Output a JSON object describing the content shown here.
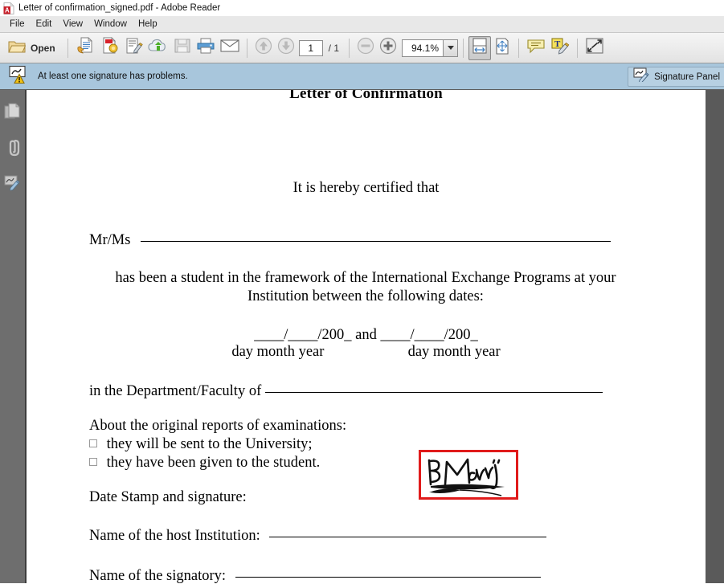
{
  "window": {
    "title": "Letter of confirmation_signed.pdf - Adobe Reader",
    "app_icon": "pdf-document-icon"
  },
  "menubar": {
    "items": [
      {
        "label": "File"
      },
      {
        "label": "Edit"
      },
      {
        "label": "View"
      },
      {
        "label": "Window"
      },
      {
        "label": "Help"
      }
    ]
  },
  "toolbar": {
    "open_label": "Open",
    "open_icon": "folder-open-icon",
    "buttons": [
      {
        "name": "create-pdf-icon",
        "label": "Create PDF"
      },
      {
        "name": "export-pdf-icon",
        "label": "Export PDF"
      },
      {
        "name": "edit-pdf-icon",
        "label": "Edit PDF"
      },
      {
        "name": "upload-cloud-icon",
        "label": "Send files"
      },
      {
        "name": "save-icon",
        "label": "Save",
        "disabled": true
      },
      {
        "name": "print-icon",
        "label": "Print"
      },
      {
        "name": "email-icon",
        "label": "Email"
      }
    ],
    "page_prev_icon": "arrow-up-icon",
    "page_next_icon": "arrow-down-icon",
    "page_number": "1",
    "page_total": "/ 1",
    "zoom_out_icon": "minus-circle-icon",
    "zoom_in_icon": "plus-circle-icon",
    "zoom_value": "94.1%",
    "right_buttons": [
      {
        "name": "fit-width-icon",
        "label": "Fit Width",
        "active": true
      },
      {
        "name": "fit-page-icon",
        "label": "Fit Page"
      },
      {
        "name": "comment-icon",
        "label": "Add Sticky Note"
      },
      {
        "name": "highlight-text-icon",
        "label": "Highlight Text"
      },
      {
        "name": "read-mode-icon",
        "label": "Read Mode"
      }
    ]
  },
  "notification": {
    "icon": "signature-warning-icon",
    "message": "At least one signature has problems.",
    "panel_button_label": "Signature Panel",
    "panel_button_icon": "signature-panel-icon"
  },
  "navpane": {
    "items": [
      {
        "name": "page-thumbnails-icon",
        "label": "Page Thumbnails"
      },
      {
        "name": "attachments-icon",
        "label": "Attachments"
      },
      {
        "name": "signatures-icon",
        "label": "Signatures"
      }
    ]
  },
  "document": {
    "title": "Letter of Confirmation",
    "certified_line": "It is hereby certified that",
    "name_label": "Mr/Ms",
    "paragraph": "has been a student in the framework of the International Exchange Programs at your Institution between the following dates:",
    "date_line": "____/____/200_  and  ____/____/200_",
    "date_labels_first": "day month year",
    "date_labels_second": "day month year",
    "department_label": "in the Department/Faculty of",
    "exams_heading": "About the original reports of examinations:",
    "exam_option_1": "they will be sent to the University;",
    "exam_option_2": "they have been given to the student.",
    "date_stamp_label": "Date Stamp and signature:",
    "host_institution_label": "Name of the host Institution:",
    "signatory_label": "Name of the signatory:",
    "signature_field": {
      "name": "signature-field",
      "border_color": "#e01b1b",
      "ink_text": "BMarijn"
    }
  },
  "colors": {
    "notification_bar": "#a8c6dc",
    "toolbar": "#ededed",
    "navpane": "#6e6e6e",
    "doc_background": "#5a5a5a",
    "signature_border": "#e01b1b"
  }
}
